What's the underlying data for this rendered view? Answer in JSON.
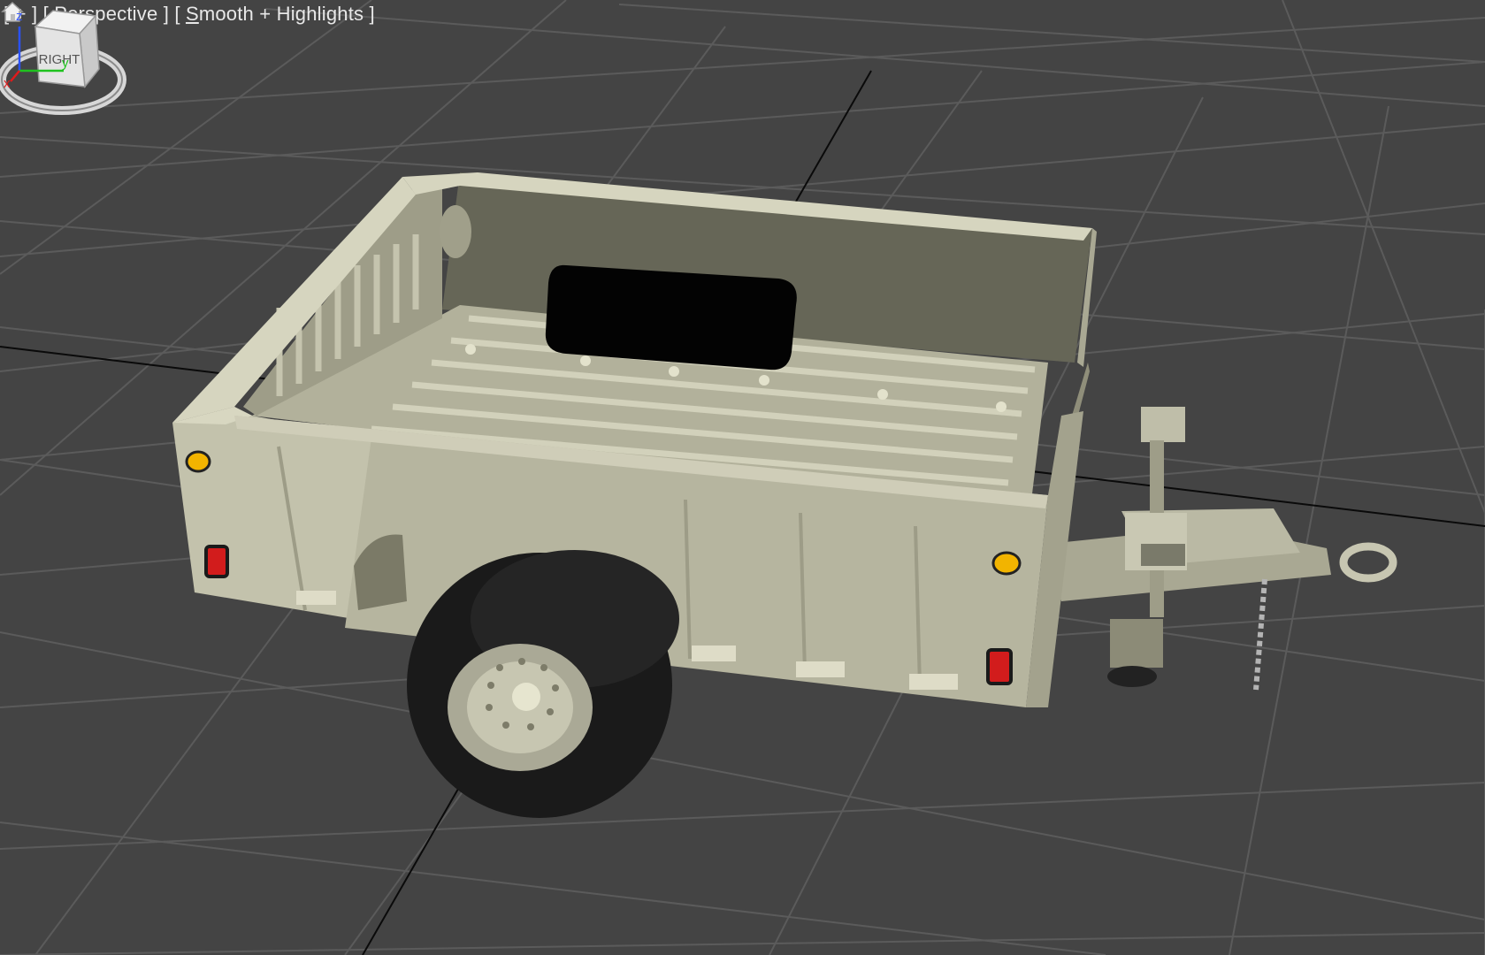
{
  "viewport": {
    "label": {
      "plus": "[ + ]",
      "view": "[ Perspective ]",
      "shading_prefix": "[ ",
      "shading_mnemonic": "S",
      "shading_rest": "mooth + Highlights ]"
    },
    "viewcube": {
      "face": "RIGHT"
    },
    "axes": {
      "z": "z",
      "y": "y",
      "x": "x"
    },
    "icons": {
      "home": "home-icon",
      "viewcube": "viewcube-icon",
      "axis": "axis-tripod-icon"
    },
    "colors": {
      "background": "#444444",
      "grid": "#5b5b5b",
      "grid_major": "#0a0a0a",
      "trailer_body": "#b8b7a1",
      "tire": "#1a1a1a",
      "reflector_amber": "#f2b400",
      "reflector_red": "#d21c1c"
    }
  }
}
